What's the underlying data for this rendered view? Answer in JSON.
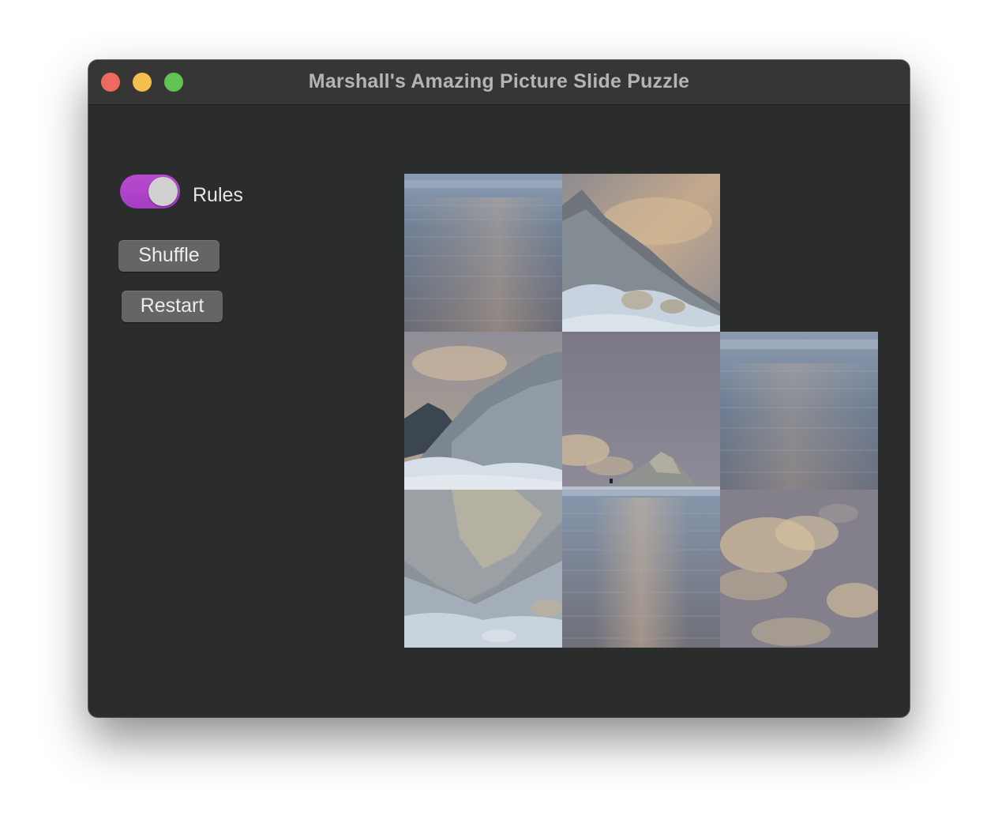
{
  "window": {
    "title": "Marshall's Amazing Picture Slide Puzzle"
  },
  "controls": {
    "rules_label": "Rules",
    "rules_enabled": true,
    "shuffle_label": "Shuffle",
    "restart_label": "Restart"
  },
  "colors": {
    "toggle_accent": "#b84bd0",
    "window_background": "#2b2c2c",
    "button_background": "#646565"
  },
  "puzzle": {
    "grid_size": 3,
    "empty_cell": "top-right",
    "tiles": [
      {
        "row": 0,
        "col": 0,
        "content": "water"
      },
      {
        "row": 0,
        "col": 1,
        "content": "mountain-slope-snow"
      },
      {
        "row": 1,
        "col": 0,
        "content": "mountain-peaks"
      },
      {
        "row": 1,
        "col": 1,
        "content": "sky-small-peak"
      },
      {
        "row": 1,
        "col": 2,
        "content": "water"
      },
      {
        "row": 2,
        "col": 0,
        "content": "mountain-ridge-snow"
      },
      {
        "row": 2,
        "col": 1,
        "content": "water-reflection"
      },
      {
        "row": 2,
        "col": 2,
        "content": "clouds"
      }
    ]
  }
}
